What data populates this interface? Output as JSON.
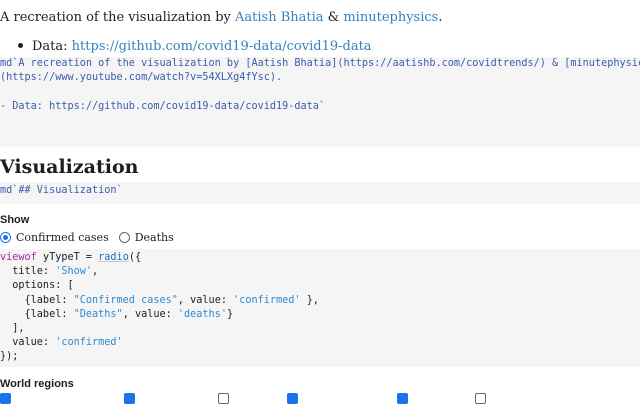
{
  "intro": {
    "prefix": "A recreation of the visualization by ",
    "author1": "Aatish Bhatia",
    "amp": " & ",
    "author2": "minutephysics",
    "suffix": "."
  },
  "data_bullet": {
    "label": "Data: ",
    "link": "https://github.com/covid19-data/covid19-data"
  },
  "cell1": {
    "line1a": "md`A recreation of the visualization by [Aatish Bhatia](https://aatishb.com/covidtrends/) & [minutephysics]",
    "line1b": "(https://www.youtube.com/watch?v=54XLXg4fYsc).",
    "line2": "- Data: https://github.com/covid19-data/covid19-data`"
  },
  "heading": {
    "text": "Visualization"
  },
  "cell2": {
    "code": "md`## Visualization`"
  },
  "show": {
    "label": "Show",
    "options": [
      "Confirmed cases",
      "Deaths"
    ],
    "selected": "Confirmed cases"
  },
  "cell3": {
    "l1_kw": "viewof",
    "l1_plain": " yTypeT = ",
    "l1_fn": "radio",
    "l1_end": "({",
    "l2_key": "  title: ",
    "l2_str": "'Show'",
    "l2_end": ",",
    "l3": "  options: [",
    "l4_a": "    {label: ",
    "l4_s1": "\"Confirmed cases\"",
    "l4_b": ", value: ",
    "l4_s2": "'confirmed'",
    "l4_c": " },",
    "l5_a": "    {label: ",
    "l5_s1": "\"Deaths\"",
    "l5_b": ", value: ",
    "l5_s2": "'deaths'",
    "l5_c": "}",
    "l6": "  ],",
    "l7_a": "  value: ",
    "l7_s": "'confirmed'",
    "l8": "});"
  },
  "regions": {
    "label": "World regions"
  },
  "colors": {
    "link": "#3182bd",
    "cell_bg": "#f5f5f5",
    "accent": "#1a73e8"
  }
}
